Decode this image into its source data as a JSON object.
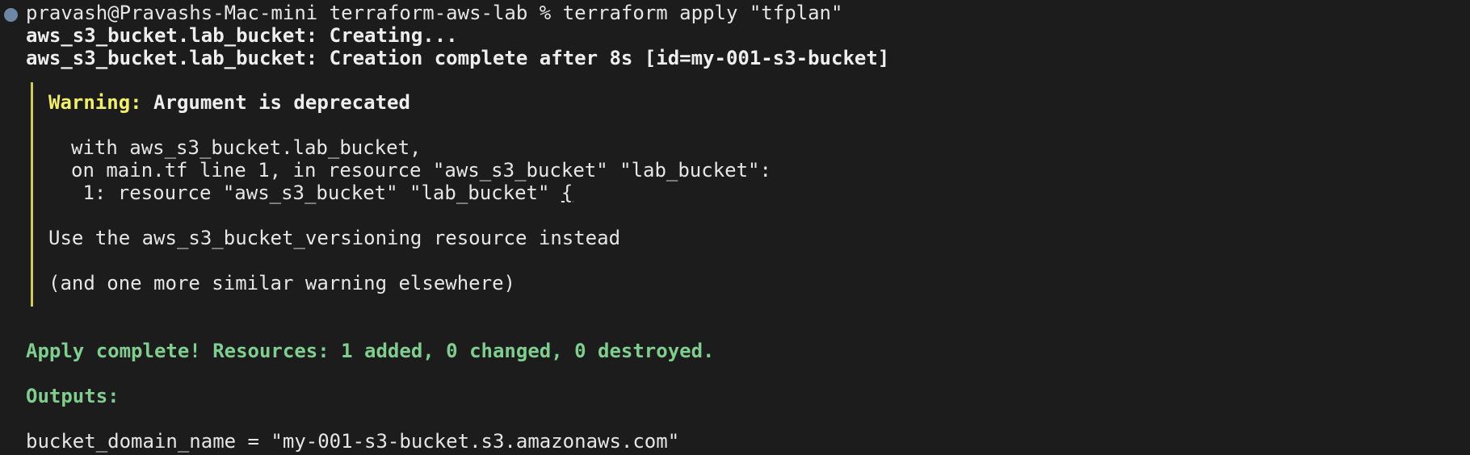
{
  "terminal": {
    "prompt": "pravash@Pravashs-Mac-mini terraform-aws-lab % ",
    "command": "terraform apply \"tfplan\"",
    "creating": "aws_s3_bucket.lab_bucket: Creating...",
    "created": "aws_s3_bucket.lab_bucket: Creation complete after 8s [id=my-001-s3-bucket]",
    "warning": {
      "label": "Warning:",
      "title": " Argument is deprecated",
      "with_line": "with aws_s3_bucket.lab_bucket,",
      "on_line": "on main.tf line 1, in resource \"aws_s3_bucket\" \"lab_bucket\":",
      "code_line": " 1: resource \"aws_s3_bucket\" \"lab_bucket\" ",
      "code_brace": "{",
      "message": "Use the aws_s3_bucket_versioning resource instead",
      "more": "(and one more similar warning elsewhere)"
    },
    "apply_complete": "Apply complete! Resources: 1 added, 0 changed, 0 destroyed.",
    "outputs_label": "Outputs:",
    "output_line": "bucket_domain_name = \"my-001-s3-bucket.s3.amazonaws.com\""
  },
  "colors": {
    "background": "#1c1c1c",
    "success": "#7fce8f",
    "warning": "#f2f06a",
    "prompt_dot": "#6c86a3"
  }
}
